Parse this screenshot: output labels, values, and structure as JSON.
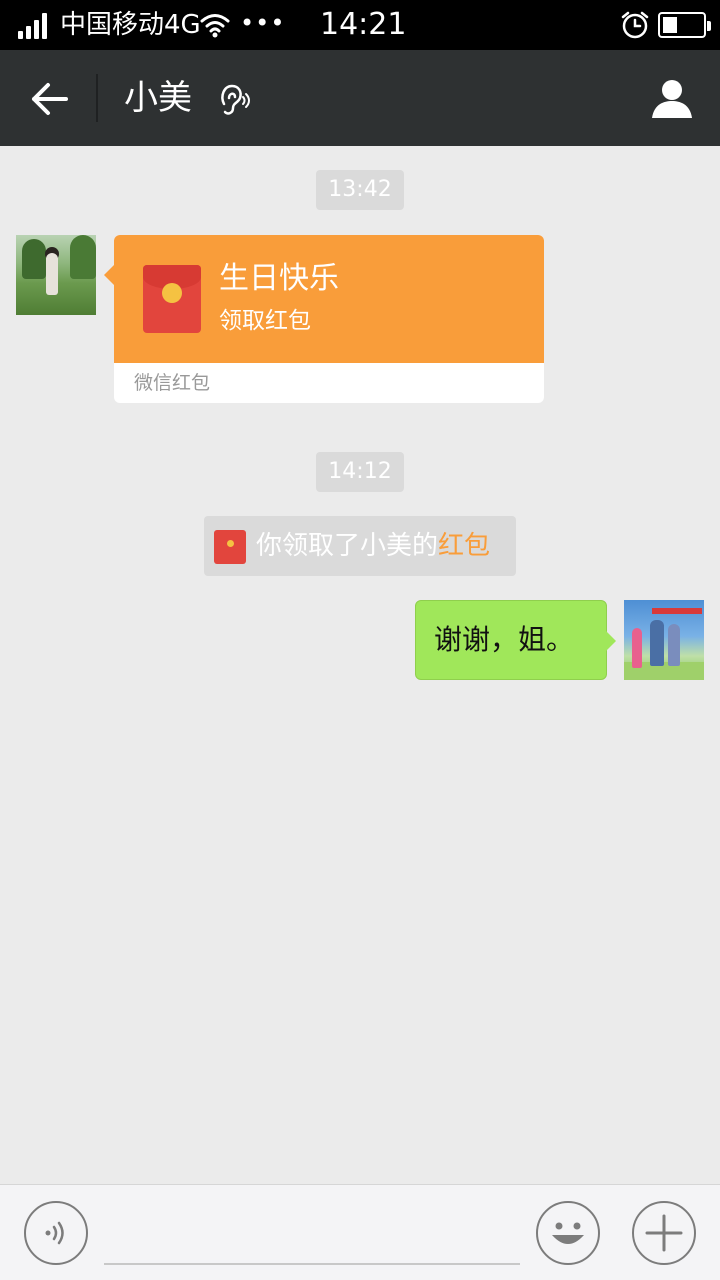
{
  "status_bar": {
    "carrier": "中国移动4G",
    "dots": "•••",
    "time": "14:21"
  },
  "nav": {
    "title": "小美"
  },
  "messages": {
    "timestamp_1": "13:42",
    "red_packet": {
      "title": "生日快乐",
      "subtitle": "领取红包",
      "footer": "微信红包"
    },
    "timestamp_2": "14:12",
    "notice": {
      "text": "你领取了小美的",
      "link": "红包"
    },
    "outgoing_text": "谢谢，姐。"
  },
  "input_bar": {
    "value": ""
  },
  "colors": {
    "nav_background": "#2e3132",
    "chat_background": "#ebebeb",
    "red_packet_orange": "#f99d3a",
    "outgoing_bubble_green": "#a0e75a",
    "red_packet_red": "#e2453d"
  },
  "icons": [
    "signal-icon",
    "wifi-icon",
    "alarm-icon",
    "battery-icon",
    "back-arrow-icon",
    "ear-icon",
    "profile-icon",
    "red-packet-icon",
    "voice-icon",
    "emoji-icon",
    "plus-icon"
  ]
}
